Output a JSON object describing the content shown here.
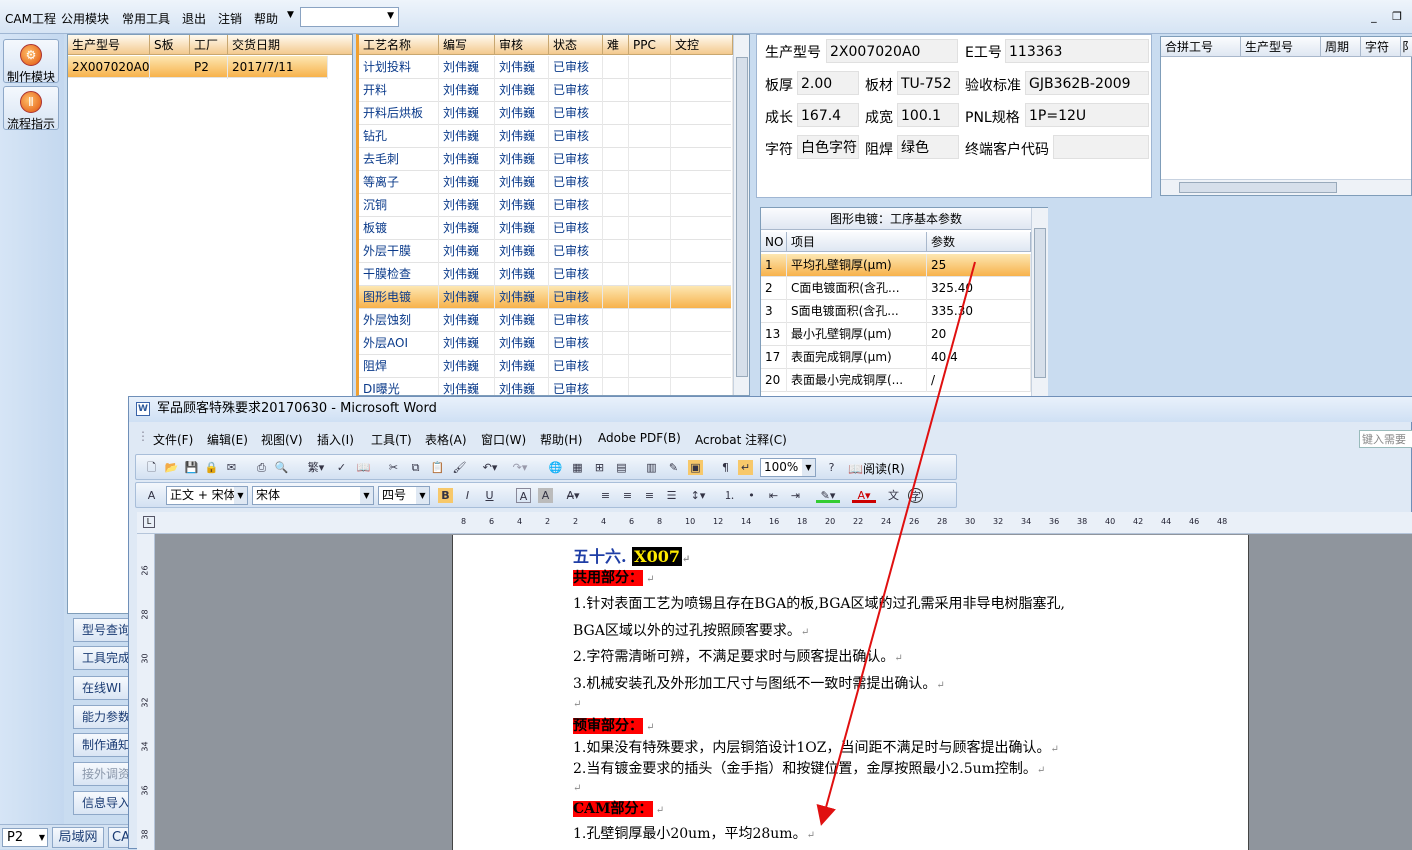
{
  "menubar": {
    "items": [
      "CAM工程",
      "公用模块",
      "常用工具",
      "退出",
      "注销",
      "帮助"
    ]
  },
  "lefttool": {
    "btn1": "制作模块",
    "btn2": "流程指示"
  },
  "order_grid": {
    "headers": [
      "生产型号",
      "S板",
      "工厂",
      "交货日期"
    ],
    "rows": [
      [
        "2X007020A0",
        "",
        "P2",
        "2017/7/11"
      ]
    ]
  },
  "process_grid": {
    "headers": [
      "工艺名称",
      "编写",
      "审核",
      "状态",
      "难",
      "PPC",
      "文控"
    ],
    "rows": [
      [
        "计划投料",
        "刘伟巍",
        "刘伟巍",
        "已审核"
      ],
      [
        "开料",
        "刘伟巍",
        "刘伟巍",
        "已审核"
      ],
      [
        "开料后烘板",
        "刘伟巍",
        "刘伟巍",
        "已审核"
      ],
      [
        "钻孔",
        "刘伟巍",
        "刘伟巍",
        "已审核"
      ],
      [
        "去毛刺",
        "刘伟巍",
        "刘伟巍",
        "已审核"
      ],
      [
        "等离子",
        "刘伟巍",
        "刘伟巍",
        "已审核"
      ],
      [
        "沉铜",
        "刘伟巍",
        "刘伟巍",
        "已审核"
      ],
      [
        "板镀",
        "刘伟巍",
        "刘伟巍",
        "已审核"
      ],
      [
        "外层干膜",
        "刘伟巍",
        "刘伟巍",
        "已审核"
      ],
      [
        "干膜检查",
        "刘伟巍",
        "刘伟巍",
        "已审核"
      ],
      [
        "图形电镀",
        "刘伟巍",
        "刘伟巍",
        "已审核"
      ],
      [
        "外层蚀刻",
        "刘伟巍",
        "刘伟巍",
        "已审核"
      ],
      [
        "外层AOI",
        "刘伟巍",
        "刘伟巍",
        "已审核"
      ],
      [
        "阻焊",
        "刘伟巍",
        "刘伟巍",
        "已审核"
      ],
      [
        "DI曝光",
        "刘伟巍",
        "刘伟巍",
        "已审核"
      ]
    ],
    "selected_index": 10
  },
  "info": {
    "l1": "生产型号",
    "v1": "2X007020A0",
    "l2": "E工号",
    "v2": "113363",
    "l3": "板厚",
    "v3": "2.00",
    "l4": "板材",
    "v4": "TU-752",
    "l5": "验收标准",
    "v5": "GJB362B-2009",
    "l6": "成长",
    "v6": "167.4",
    "l7": "成宽",
    "v7": "100.1",
    "l8": "PNL规格",
    "v8": "1P=12U",
    "l9": "字符",
    "v9": "白色字符",
    "l10": "阻焊",
    "v10": "绿色",
    "l11": "终端客户代码",
    "v11": ""
  },
  "merge_grid": {
    "headers": [
      "合拼工号",
      "生产型号",
      "周期",
      "字符",
      "阝"
    ]
  },
  "params": {
    "title": "图形电镀：工序基本参数",
    "headers": [
      "NO",
      "项目",
      "参数"
    ],
    "rows": [
      [
        "1",
        "平均孔壁铜厚(μm)",
        "25"
      ],
      [
        "2",
        "C面电镀面积(含孔...",
        "325.40"
      ],
      [
        "3",
        "S面电镀面积(含孔...",
        "335.30"
      ],
      [
        "13",
        "最小孔壁铜厚(μm)",
        "20"
      ],
      [
        "17",
        "表面完成铜厚(μm)",
        "40.4"
      ],
      [
        "20",
        "表面最小完成铜厚(...",
        "/"
      ]
    ]
  },
  "side_buttons": [
    "型号查询",
    "工具完成",
    "在线WI",
    "能力参数",
    "制作通知",
    "接外调资",
    "信息导入"
  ],
  "status": {
    "combo": "P2",
    "lan": "局域网",
    "ca": "CA"
  },
  "word": {
    "title": "军品顾客特殊要求20170630 - Microsoft Word",
    "menu": [
      "文件(F)",
      "编辑(E)",
      "视图(V)",
      "插入(I)",
      "工具(T)",
      "表格(A)",
      "窗口(W)",
      "帮助(H)",
      "Adobe PDF(B)",
      "Acrobat 注释(C)"
    ],
    "help_placeholder": "键入需要",
    "zoom": "100%",
    "read": "阅读(R)",
    "style": "正文 + 宋体",
    "font": "宋体",
    "size": "四号",
    "ruler": [
      "8",
      "6",
      "4",
      "2",
      "2",
      "4",
      "6",
      "8",
      "10",
      "12",
      "14",
      "16",
      "18",
      "20",
      "22",
      "24",
      "26",
      "28",
      "30",
      "32",
      "34",
      "36",
      "38",
      "40",
      "42",
      "44",
      "46",
      "48"
    ],
    "vruler": [
      "26",
      "28",
      "30",
      "32",
      "34",
      "36",
      "38"
    ],
    "doc": {
      "heading_prefix": "五十六. ",
      "heading_code": "X007",
      "s1": "共用部分：",
      "p1": "1.针对表面工艺为喷锡且存在BGA的板,BGA区域的过孔需采用非导电树脂塞孔,",
      "p1b": "BGA区域以外的过孔按照顾客要求。",
      "p2": "2.字符需清晰可辨，不满足要求时与顾客提出确认。",
      "p3": "3.机械安装孔及外形加工尺寸与图纸不一致时需提出确认。",
      "s2": "预审部分：",
      "p4": "1.如果没有特殊要求，内层铜箔设计1OZ，当间距不满足时与顾客提出确认。",
      "p5": "2.当有镀金要求的插头（金手指）和按键位置，金厚按照最小2.5um控制。",
      "s3": "CAM部分：",
      "p6": "1.孔壁铜厚最小20um，平均28um。"
    }
  }
}
